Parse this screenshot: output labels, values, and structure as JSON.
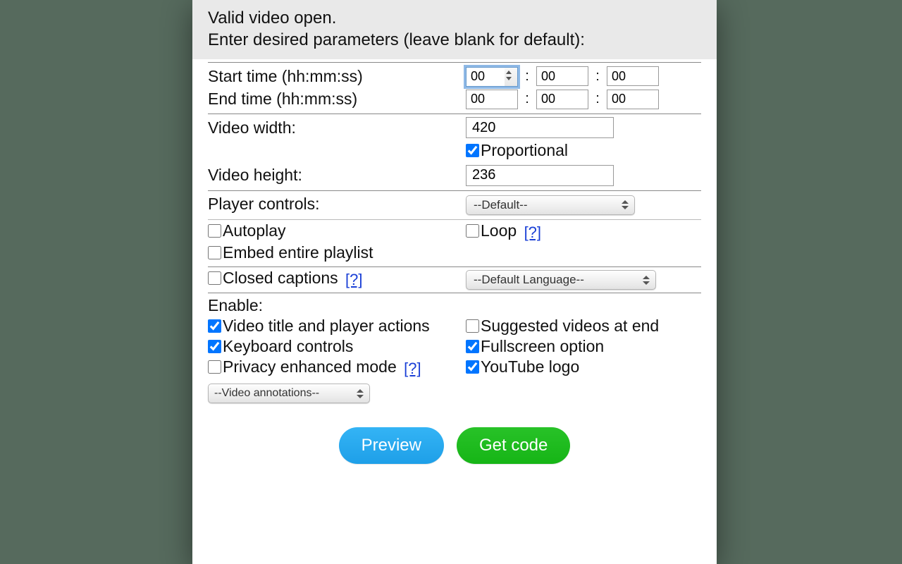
{
  "header": {
    "line1": "Valid video open.",
    "line2": "Enter desired parameters (leave blank for default):"
  },
  "start_time": {
    "label": "Start time (hh:mm:ss)",
    "hh": "00",
    "mm": "00",
    "ss": "00"
  },
  "end_time": {
    "label": "End time (hh:mm:ss)",
    "hh": "00",
    "mm": "00",
    "ss": "00"
  },
  "width": {
    "label": "Video width:",
    "value": "420"
  },
  "proportional": {
    "label": "Proportional",
    "checked": true
  },
  "height": {
    "label": "Video height:",
    "value": "236"
  },
  "player_controls": {
    "label": "Player controls:",
    "selected": "--Default--"
  },
  "autoplay": {
    "label": "Autoplay",
    "checked": false
  },
  "loop": {
    "label": "Loop",
    "checked": false,
    "help": "[?]"
  },
  "embed_playlist": {
    "label": "Embed entire playlist",
    "checked": false
  },
  "closed_captions": {
    "label": "Closed captions",
    "checked": false,
    "help": "[?]"
  },
  "cc_language": {
    "selected": "--Default Language--"
  },
  "enable": {
    "heading": "Enable:",
    "video_title_actions": {
      "label": "Video title and player actions",
      "checked": true
    },
    "suggested_end": {
      "label": "Suggested videos at end",
      "checked": false
    },
    "keyboard_controls": {
      "label": "Keyboard controls",
      "checked": true
    },
    "fullscreen": {
      "label": "Fullscreen option",
      "checked": true
    },
    "privacy_mode": {
      "label": "Privacy enhanced mode",
      "checked": false,
      "help": "[?]"
    },
    "youtube_logo": {
      "label": "YouTube logo",
      "checked": true
    },
    "annotations_select": "--Video annotations--"
  },
  "buttons": {
    "preview": "Preview",
    "get_code": "Get code"
  }
}
